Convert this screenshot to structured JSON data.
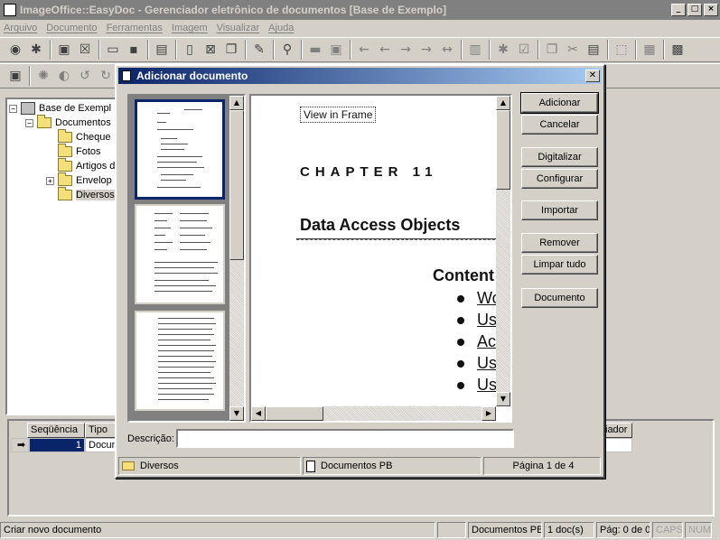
{
  "window": {
    "title": "ImageOffice::EasyDoc - Gerenciador eletrônico de documentos [Base de Exemplo]",
    "controls": [
      "_",
      "□",
      "×"
    ]
  },
  "menu": [
    "Arquivo",
    "Documento",
    "Ferramentas",
    "Imagem",
    "Visualizar",
    "Ajuda"
  ],
  "tree": {
    "root": "Base de Exempl",
    "documentos": "Documentos",
    "items": [
      "Cheque",
      "Fotos",
      "Artigos d",
      "Envelop",
      "Diversos"
    ]
  },
  "grid": {
    "headers": [
      "Seqüência",
      "Tipo",
      "iador"
    ],
    "row": {
      "seq": "1",
      "tipo": "Docun"
    }
  },
  "status": {
    "message": "Criar novo documento",
    "blank": "",
    "doc_type": "Documentos PB",
    "count": "1 doc(s)",
    "page": "Pág: 0 de 0",
    "caps": "CAPS",
    "num": "NUM"
  },
  "dialog": {
    "title": "Adicionar documento",
    "buttons": {
      "add": "Adicionar",
      "cancel": "Cancelar",
      "scan": "Digitalizar",
      "configure": "Configurar",
      "import": "Importar",
      "remove": "Remover",
      "clear": "Limpar tudo",
      "document": "Documento"
    },
    "description_label": "Descrição:",
    "description_value": "",
    "status": {
      "folder": "Diversos",
      "doc_type": "Documentos PB",
      "page": "Página 1 de 4"
    },
    "preview": {
      "frame": "View in Frame",
      "chapter": "CHAPTER 11",
      "title": "Data Access Objects",
      "contents": "Content",
      "bullets": [
        "Wo",
        "Us",
        "Ac",
        "Us",
        "Us"
      ]
    }
  }
}
